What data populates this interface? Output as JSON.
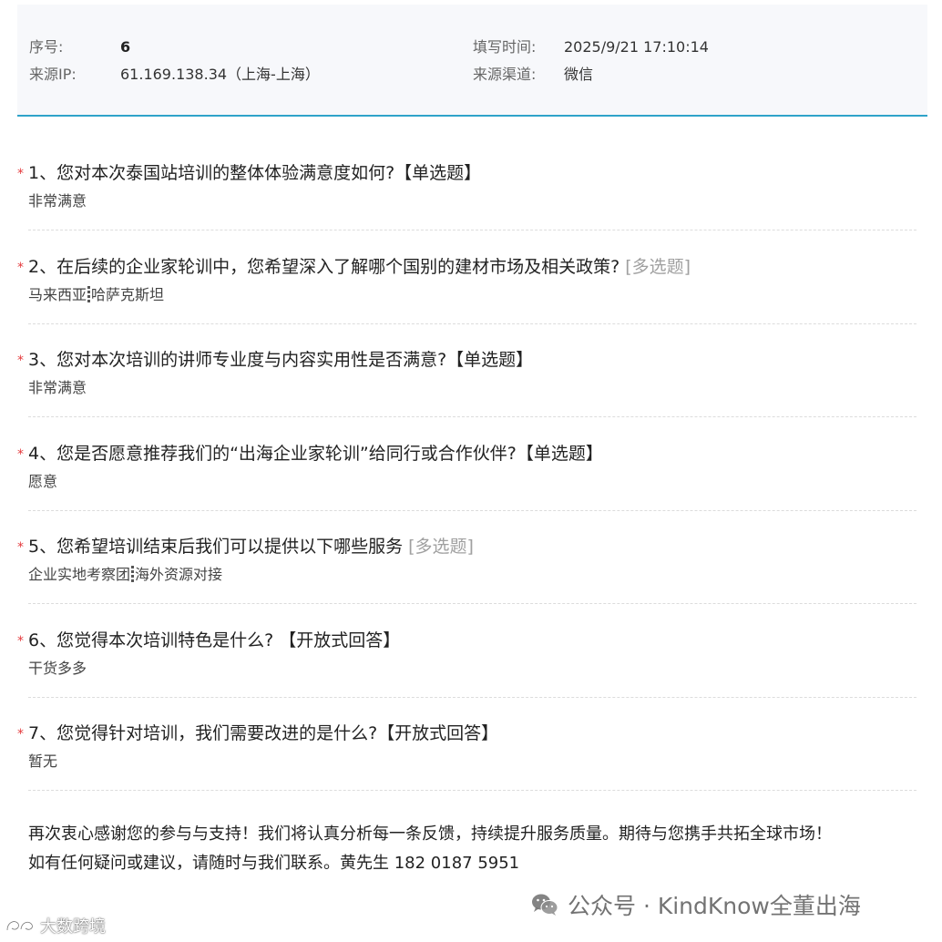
{
  "info": {
    "serial_label": "序号:",
    "serial_value": "6",
    "ip_label": "来源IP:",
    "ip_value": "61.169.138.34（上海-上海）",
    "time_label": "填写时间:",
    "time_value": "2025/9/21 17:10:14",
    "channel_label": "来源渠道:",
    "channel_value": "微信"
  },
  "questions": [
    {
      "required": "*",
      "title": "1、您对本次泰国站培训的整体体验满意度如何?【单选题】",
      "type_tag": "",
      "answers": [
        "非常满意"
      ]
    },
    {
      "required": "*",
      "title": "2、在后续的企业家轮训中，您希望深入了解哪个国别的建材市场及相关政策?",
      "type_tag": "[多选题]",
      "answers": [
        "马来西亚",
        "哈萨克斯坦"
      ]
    },
    {
      "required": "*",
      "title": "3、您对本次培训的讲师专业度与内容实用性是否满意?【单选题】",
      "type_tag": "",
      "answers": [
        "非常满意"
      ]
    },
    {
      "required": "*",
      "title": "4、您是否愿意推荐我们的“出海企业家轮训”给同行或合作伙伴?【单选题】",
      "type_tag": "",
      "answers": [
        "愿意"
      ]
    },
    {
      "required": "*",
      "title": "5、您希望培训结束后我们可以提供以下哪些服务",
      "type_tag": "[多选题]",
      "answers": [
        "企业实地考察团",
        "海外资源对接"
      ]
    },
    {
      "required": "*",
      "title": "6、您觉得本次培训特色是什么? 【开放式回答】",
      "type_tag": "",
      "answers": [
        "干货多多"
      ]
    },
    {
      "required": "*",
      "title": "7、您觉得针对培训，我们需要改进的是什么?【开放式回答】",
      "type_tag": "",
      "answers": [
        "暂无"
      ]
    }
  ],
  "closing": {
    "line1": "再次衷心感谢您的参与与支持！我们将认真分析每一条反馈，持续提升服务质量。期待与您携手共拓全球市场！",
    "line2": "如有任何疑问或建议，请随时与我们联系。黄先生 182 0187 5951"
  },
  "watermarks": {
    "wechat_text": "公众号 · KindKnow全董出海",
    "small_text": "大数跨境"
  }
}
